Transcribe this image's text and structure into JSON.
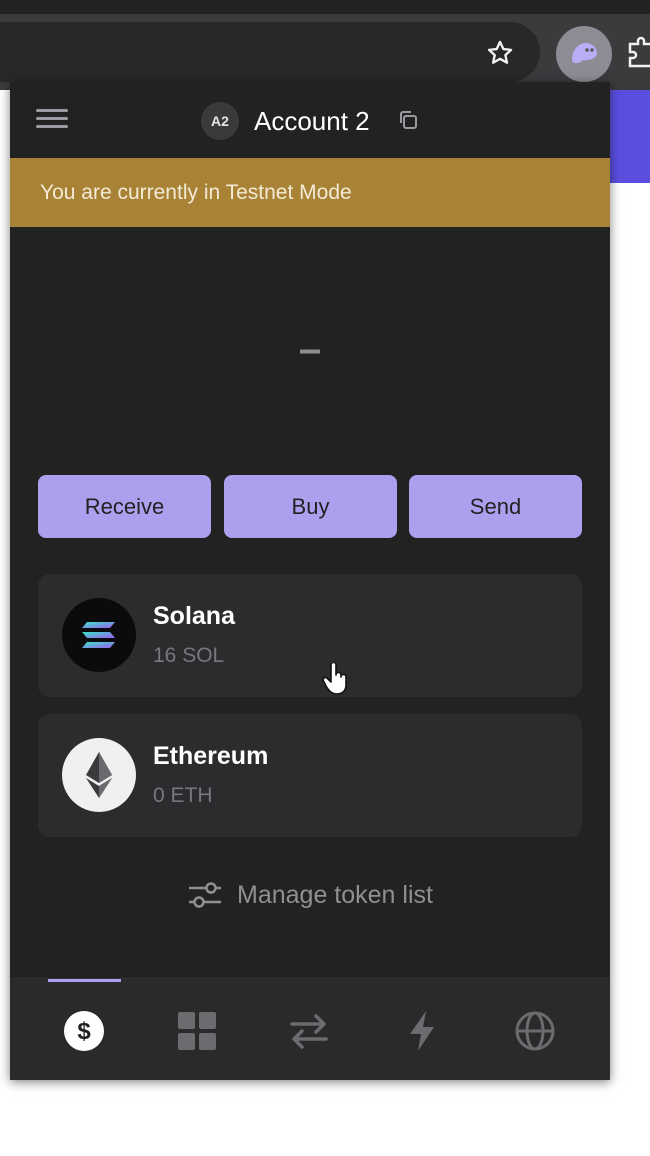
{
  "browser": {
    "bookmark_icon": "star-icon",
    "extension_icon": "phantom-ghost-icon",
    "extensions_menu_icon": "puzzle-icon"
  },
  "wallet": {
    "header": {
      "avatar_initials": "A2",
      "account_name": "Account 2",
      "menu_icon": "hamburger-icon",
      "copy_icon": "copy-icon"
    },
    "banner": {
      "text": "You are currently in Testnet Mode"
    },
    "balance": {
      "value": "–"
    },
    "actions": [
      {
        "label": "Receive"
      },
      {
        "label": "Buy"
      },
      {
        "label": "Send"
      }
    ],
    "tokens": [
      {
        "name": "Solana",
        "amount": "16 SOL",
        "icon": "solana-logo-icon"
      },
      {
        "name": "Ethereum",
        "amount": "0 ETH",
        "icon": "ethereum-logo-icon"
      }
    ],
    "manage_link": {
      "label": "Manage token list",
      "icon": "sliders-icon"
    },
    "tabs": [
      {
        "icon": "dollar-icon",
        "active": true
      },
      {
        "icon": "grid-icon",
        "active": false
      },
      {
        "icon": "swap-icon",
        "active": false
      },
      {
        "icon": "bolt-icon",
        "active": false
      },
      {
        "icon": "globe-icon",
        "active": false
      }
    ]
  },
  "colors": {
    "accent": "#aba0ee",
    "banner": "#a88336",
    "background": "#222222",
    "card": "#2c2c2e"
  }
}
